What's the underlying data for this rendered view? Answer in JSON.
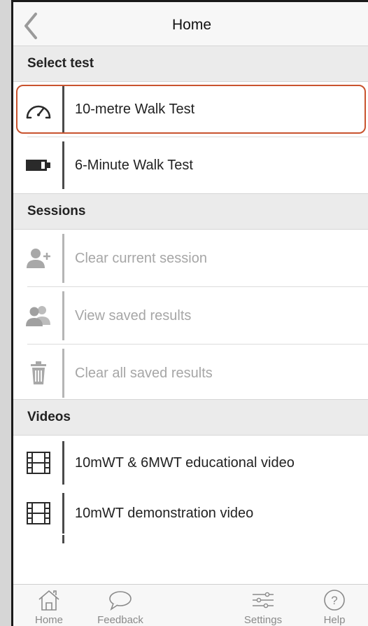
{
  "nav": {
    "title": "Home"
  },
  "sections": {
    "select_test": "Select test",
    "sessions": "Sessions",
    "videos": "Videos"
  },
  "tests": [
    {
      "label": "10-metre Walk Test",
      "icon": "speedometer-icon",
      "selected": true
    },
    {
      "label": "6-Minute Walk Test",
      "icon": "battery-icon"
    }
  ],
  "sessions": [
    {
      "label": "Clear current session",
      "icon": "add-user-icon"
    },
    {
      "label": "View saved results",
      "icon": "users-icon"
    },
    {
      "label": "Clear all saved results",
      "icon": "trash-icon"
    }
  ],
  "videos": [
    {
      "label": "10mWT & 6MWT educational video",
      "icon": "film-icon"
    },
    {
      "label": "10mWT demonstration video",
      "icon": "film-icon"
    }
  ],
  "tabbar": [
    {
      "label": "Home",
      "icon": "home-icon"
    },
    {
      "label": "Feedback",
      "icon": "speech-bubble-icon"
    },
    {
      "label": "Settings",
      "icon": "sliders-icon"
    },
    {
      "label": "Help",
      "icon": "question-icon"
    }
  ],
  "colors": {
    "selection_border": "#c9532e",
    "section_bg": "#ebebeb"
  }
}
